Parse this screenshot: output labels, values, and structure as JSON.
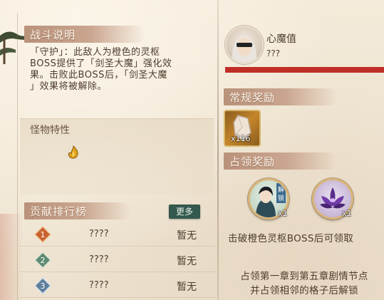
{
  "battle": {
    "header": "战斗说明",
    "description_lines": [
      "「守护」：此敌人为橙色的灵枢",
      "BOSS提供了「剑圣大魔」强化效",
      "果。击败此BOSS后，「剑圣大魔",
      "」效果将被解除。"
    ]
  },
  "traits": {
    "title": "怪物特性",
    "icon": "golden-flame-icon"
  },
  "ranking": {
    "header": "贡献排行榜",
    "more_label": "更多",
    "rows": [
      {
        "rank": "1",
        "name": "????",
        "score": "暂无",
        "badge_color": "#c9612e"
      },
      {
        "rank": "2",
        "name": "????",
        "score": "暂无",
        "badge_color": "#5f8a73"
      },
      {
        "rank": "3",
        "name": "????",
        "score": "暂无",
        "badge_color": "#5d7d9a"
      }
    ]
  },
  "boss": {
    "label": "心魔值",
    "value": "???",
    "avatar": "masked-white-hair-avatar",
    "bar_color": "#bf2f27",
    "bar_fill": 1.0
  },
  "regular_reward": {
    "header": "常规奖励",
    "item_icon": "jade-shard-icon",
    "count": "x116"
  },
  "occupy_reward": {
    "header": "占领奖励",
    "items": [
      {
        "icon": "character-portrait-icon",
        "tag": "解锁",
        "count": "x1"
      },
      {
        "icon": "purple-lotus-icon",
        "count": "x1"
      }
    ],
    "unlock_note": "击破橙色灵枢BOSS后可领取",
    "chapter_note_lines": [
      "占领第一章到第五章剧情节点",
      "并占领相邻的格子后解锁"
    ]
  }
}
